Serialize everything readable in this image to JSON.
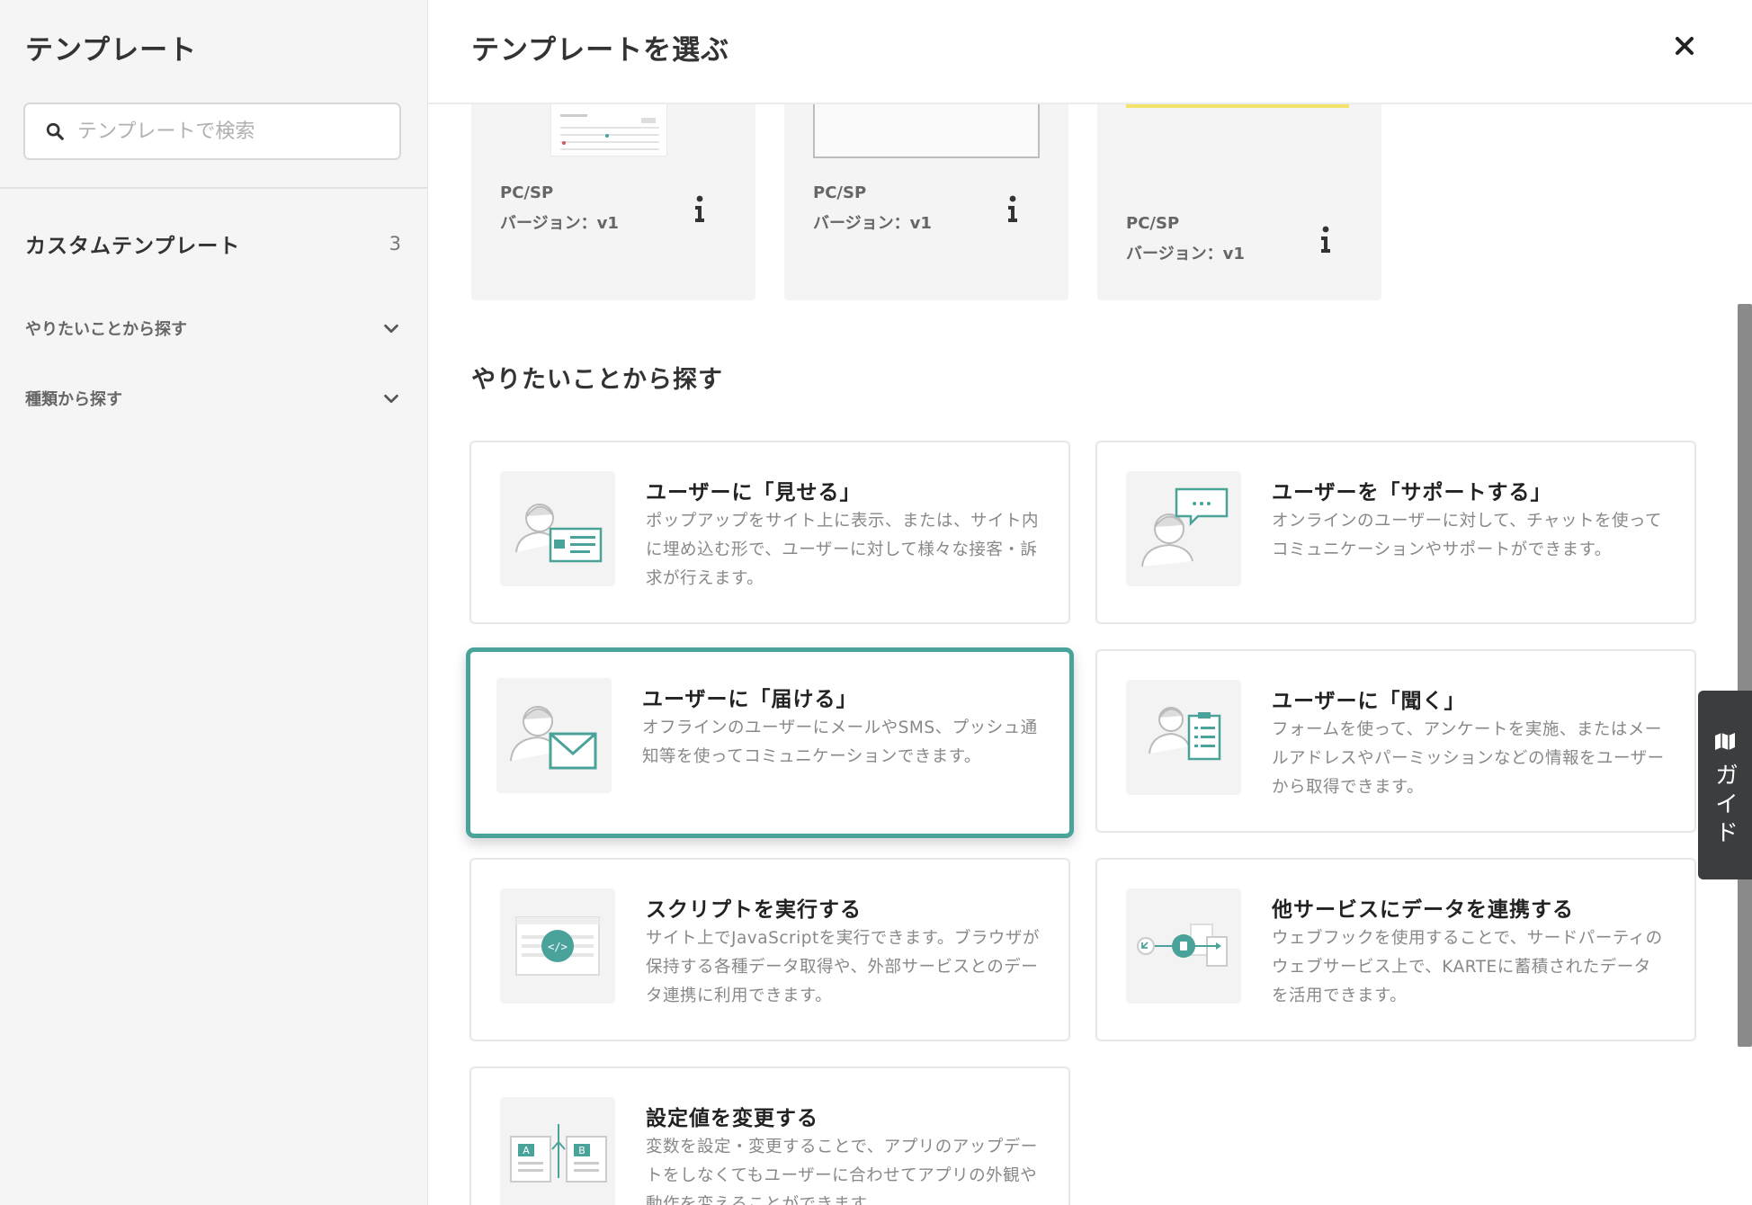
{
  "sidebar": {
    "title": "テンプレート",
    "search_placeholder": "テンプレートで検索",
    "custom_templates": {
      "label": "カスタムテンプレート",
      "count": "3"
    },
    "sections": [
      {
        "label": "やりたいことから探す"
      },
      {
        "label": "種類から探す"
      }
    ]
  },
  "main": {
    "title": "テンプレートを選ぶ",
    "template_cards": [
      {
        "device": "PC/SP",
        "version": "バージョン：v1"
      },
      {
        "device": "PC/SP",
        "version": "バージョン：v1"
      },
      {
        "device": "PC/SP",
        "version": "バージョン：v1"
      }
    ],
    "section_title": "やりたいことから探す",
    "purposes": [
      {
        "title": "ユーザーに「見せる」",
        "description": "ポップアップをサイト上に表示、または、サイト内に埋め込む形で、ユーザーに対して様々な接客・訴求が行えます。"
      },
      {
        "title": "ユーザーを「サポートする」",
        "description": "オンラインのユーザーに対して、チャットを使ってコミュニケーションやサポートができます。"
      },
      {
        "title": "ユーザーに「届ける」",
        "description": "オフラインのユーザーにメールやSMS、プッシュ通知等を使ってコミュニケーションできます。"
      },
      {
        "title": "ユーザーに「聞く」",
        "description": "フォームを使って、アンケートを実施、またはメールアドレスやパーミッションなどの情報をユーザーから取得できます。"
      },
      {
        "title": "スクリプトを実行する",
        "description": "サイト上でJavaScriptを実行できます。ブラウザが保持する各種データ取得や、外部サービスとのデータ連携に利用できます。"
      },
      {
        "title": "他サービスにデータを連携する",
        "description": "ウェブフックを使用することで、サードパーティのウェブサービス上で、KARTEに蓄積されたデータを活用できます。"
      },
      {
        "title": "設定値を変更する",
        "description": "変数を設定・変更することで、アプリのアップデートをしなくてもユーザーに合わせてアプリの外観や動作を変えることができます。"
      }
    ]
  },
  "guide": {
    "label": "ガイド"
  },
  "colors": {
    "accent": "#4aa39a",
    "guide_bg": "#3b3e3e",
    "highlight_bar": "#f2e36a"
  }
}
